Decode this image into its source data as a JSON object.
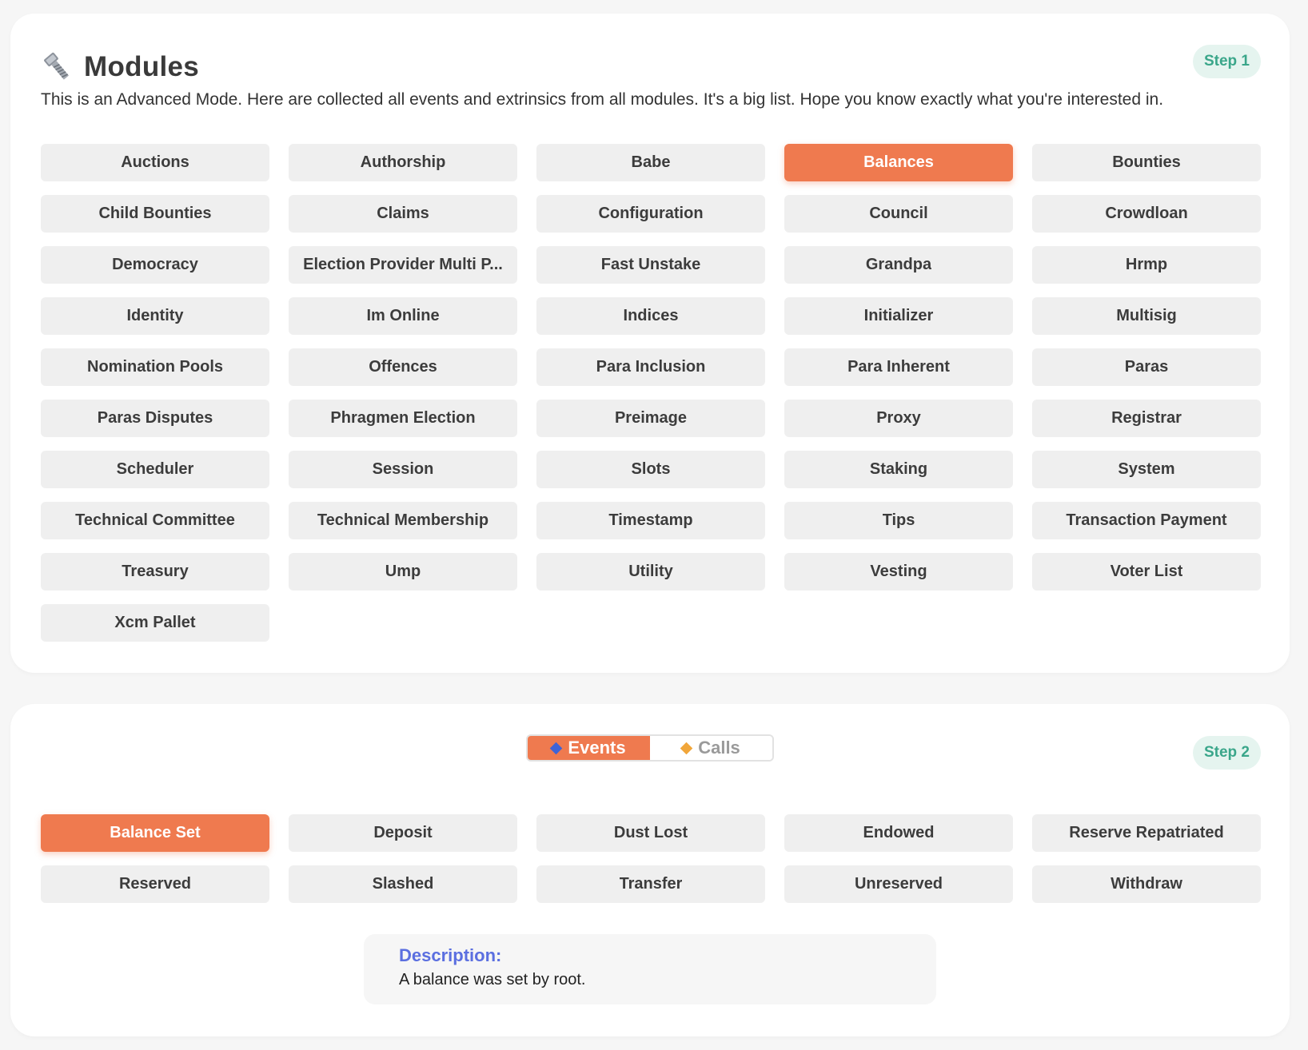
{
  "modules_card": {
    "title": "Modules",
    "title_icon": "bolt-icon",
    "subtitle": "This is an Advanced Mode. Here are collected all events and extrinsics from all modules. It's a big list. Hope you know exactly what you're interested in.",
    "step": "Step 1",
    "selected": "Balances",
    "modules": [
      "Auctions",
      "Authorship",
      "Babe",
      "Balances",
      "Bounties",
      "Child Bounties",
      "Claims",
      "Configuration",
      "Council",
      "Crowdloan",
      "Democracy",
      "Election Provider Multi P...",
      "Fast Unstake",
      "Grandpa",
      "Hrmp",
      "Identity",
      "Im Online",
      "Indices",
      "Initializer",
      "Multisig",
      "Nomination Pools",
      "Offences",
      "Para Inclusion",
      "Para Inherent",
      "Paras",
      "Paras Disputes",
      "Phragmen Election",
      "Preimage",
      "Proxy",
      "Registrar",
      "Scheduler",
      "Session",
      "Slots",
      "Staking",
      "System",
      "Technical Committee",
      "Technical Membership",
      "Timestamp",
      "Tips",
      "Transaction Payment",
      "Treasury",
      "Ump",
      "Utility",
      "Vesting",
      "Voter List",
      "Xcm Pallet"
    ]
  },
  "events_card": {
    "step": "Step 2",
    "toggle": {
      "events_label": "Events",
      "calls_label": "Calls",
      "active": "Events"
    },
    "selected": "Balance Set",
    "events": [
      "Balance Set",
      "Deposit",
      "Dust Lost",
      "Endowed",
      "Reserve Repatriated",
      "Reserved",
      "Slashed",
      "Transfer",
      "Unreserved",
      "Withdraw"
    ],
    "description_label": "Description:",
    "description_text": "A balance was set by root."
  },
  "colors": {
    "accent": "#ef7a4f",
    "chip_bg": "#efefef",
    "step_badge_bg": "#e5f4ef",
    "step_badge_text": "#3aa68a",
    "description_label": "#5b6fe0"
  }
}
